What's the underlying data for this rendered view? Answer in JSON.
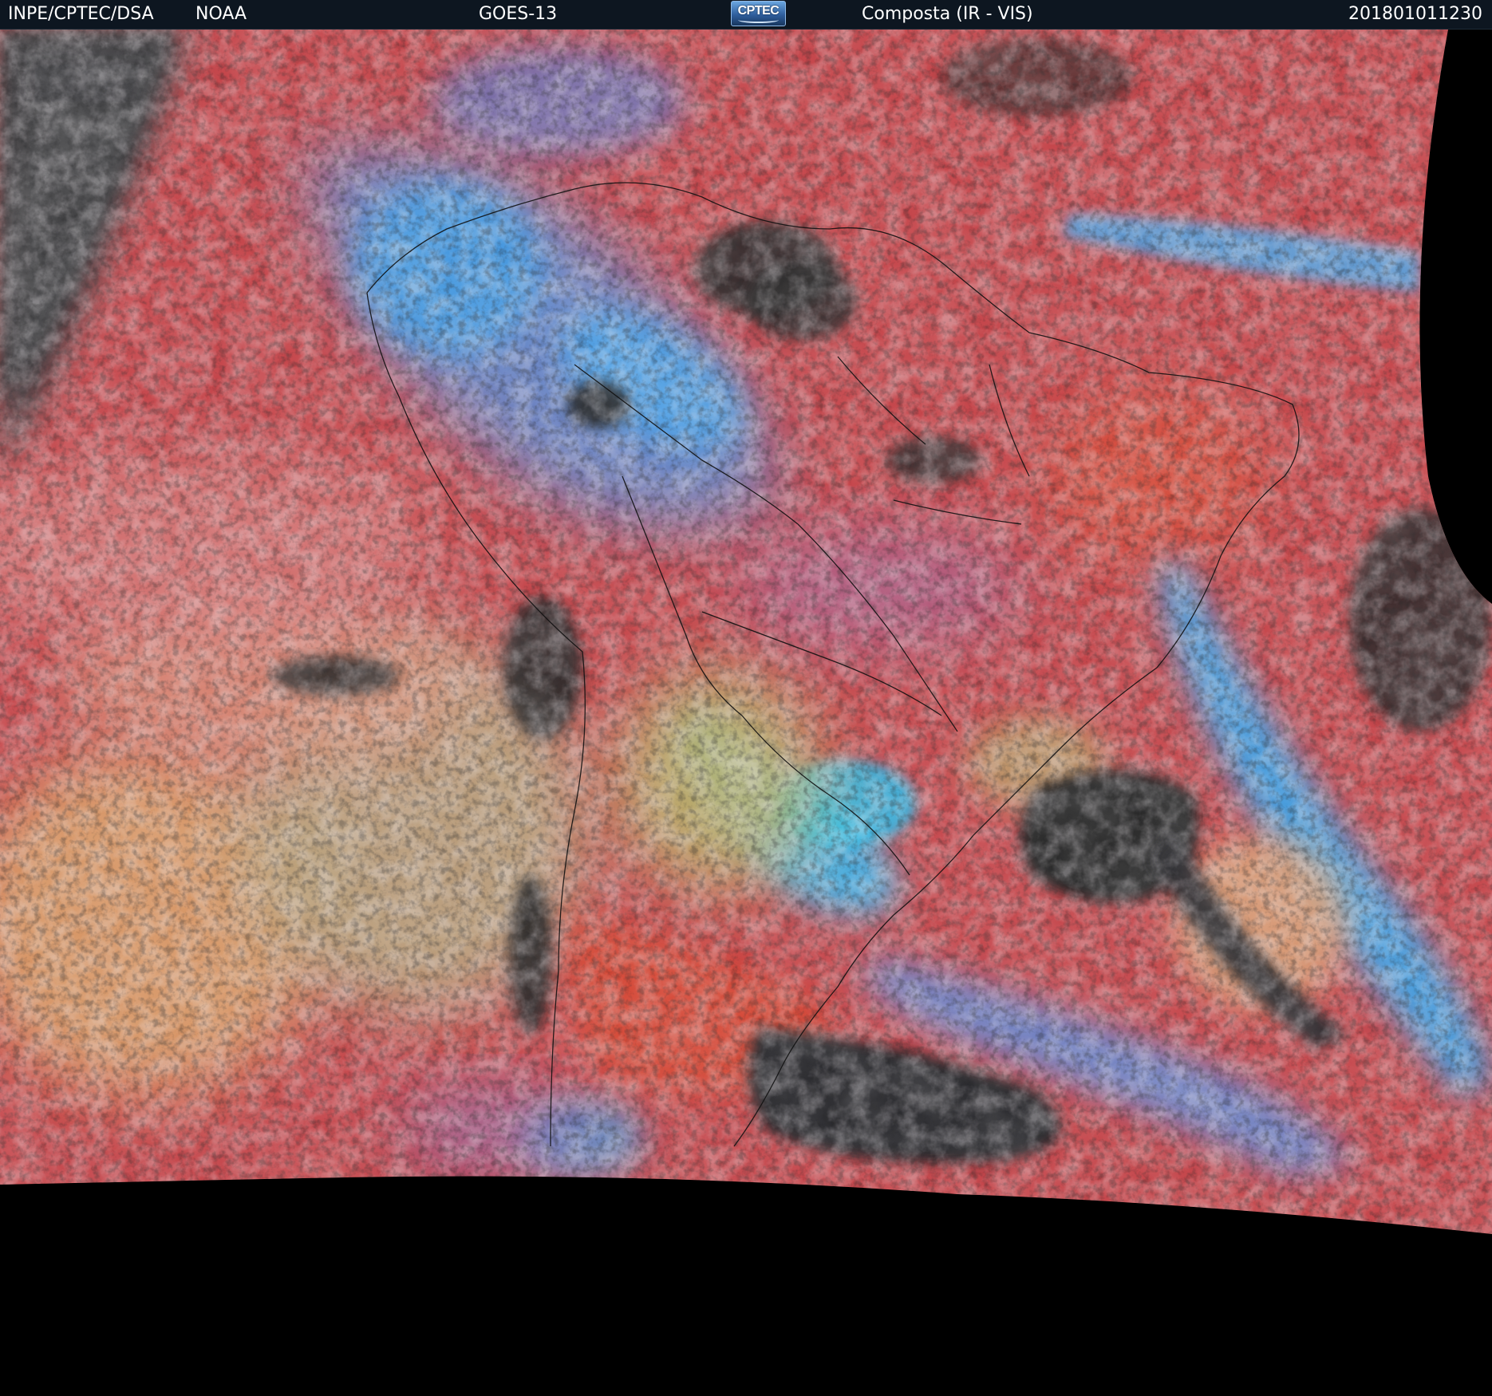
{
  "header": {
    "source": "INPE/CPTEC/DSA",
    "agency": "NOAA",
    "satellite": "GOES-13",
    "logo_text": "CPTEC",
    "product": "Composta (IR - VIS)",
    "timestamp": "201801011230"
  },
  "image": {
    "background_color": "#000000",
    "dominant_colors": [
      "#c8464a",
      "#d84f3a",
      "#3fa8e8",
      "#b8b07a",
      "#2b2b2b",
      "#8c6fb0"
    ]
  }
}
